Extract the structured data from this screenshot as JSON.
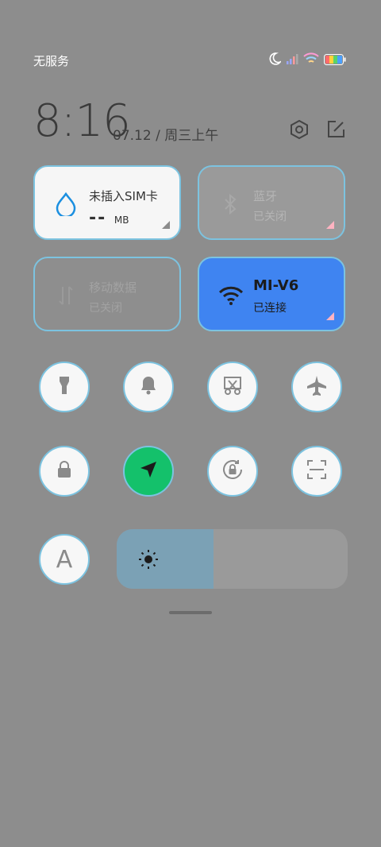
{
  "status_bar": {
    "carrier": "无服务"
  },
  "header": {
    "time": "8:16",
    "date": "07.12 / 周三上午"
  },
  "tiles": {
    "sim": {
      "title": "未插入SIM卡",
      "value": "-- ",
      "unit": "MB"
    },
    "bluetooth": {
      "title": "蓝牙",
      "subtitle": "已关闭"
    },
    "mobile_data": {
      "title": "移动数据",
      "subtitle": "已关闭"
    },
    "wifi": {
      "title": "MI-V6",
      "subtitle": "已连接"
    }
  },
  "toggles": [
    {
      "icon": "flashlight-icon",
      "active": false
    },
    {
      "icon": "bell-icon",
      "active": false
    },
    {
      "icon": "screenshot-icon",
      "active": false
    },
    {
      "icon": "airplane-icon",
      "active": false
    },
    {
      "icon": "lock-icon",
      "active": false
    },
    {
      "icon": "location-icon",
      "active": true
    },
    {
      "icon": "rotation-lock-icon",
      "active": false
    },
    {
      "icon": "scan-icon",
      "active": false
    },
    {
      "icon": "font-a-icon",
      "active": false
    }
  ],
  "brightness": {
    "level": 0.42
  },
  "colors": {
    "wifi_active": "#3f84f1",
    "location_active": "#14c16b",
    "accent_border": "#7cc3e0"
  },
  "font_toggle_letter": "A"
}
